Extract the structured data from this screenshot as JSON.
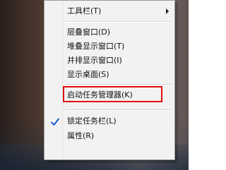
{
  "menu": {
    "items": [
      {
        "label": "工具栏(T)"
      },
      {
        "label": "层叠窗口(D)"
      },
      {
        "label": "堆叠显示窗口(T)"
      },
      {
        "label": "并排显示窗口(I)"
      },
      {
        "label": "显示桌面(S)"
      },
      {
        "label": "启动任务管理器(K)"
      },
      {
        "label": "锁定任务栏(L)"
      },
      {
        "label": "属性(R)"
      }
    ],
    "checked_item": "锁定任务栏(L)",
    "icons": {
      "submenu": "chevron-right-icon",
      "check": "checkmark-icon"
    },
    "highlight_color": "#e01010",
    "check_color": "#1a5fd0"
  }
}
